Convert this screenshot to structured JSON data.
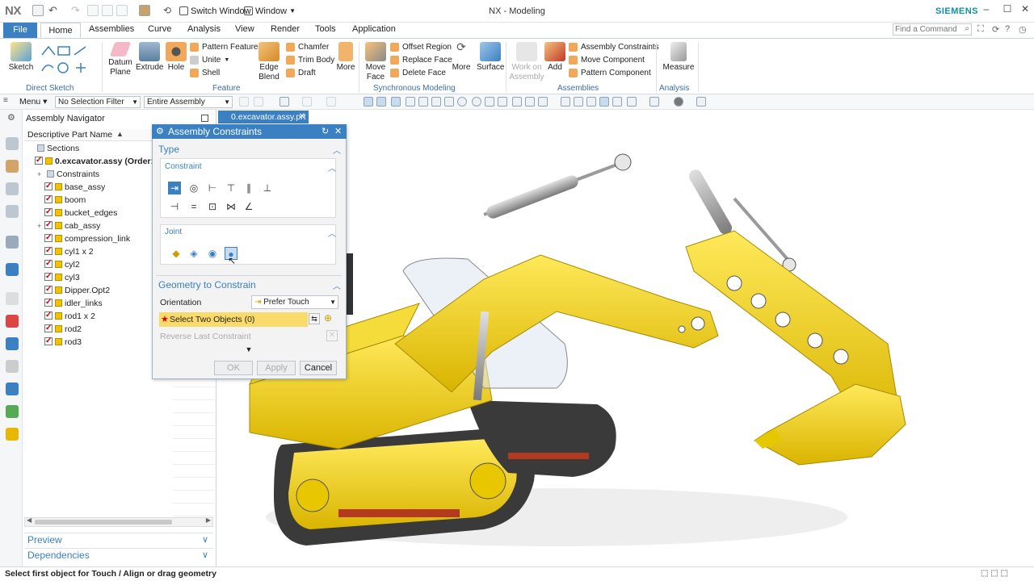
{
  "app": {
    "logo": "NX",
    "title": "NX - Modeling",
    "brand": "SIEMENS"
  },
  "quick_access": {
    "switch_window": "Switch Window",
    "window": "Window"
  },
  "tabs": [
    "File",
    "Home",
    "Assemblies",
    "Curve",
    "Analysis",
    "View",
    "Render",
    "Tools",
    "Application"
  ],
  "search": {
    "placeholder": "Find a Command"
  },
  "ribbon": {
    "direct_sketch": {
      "name": "Direct Sketch",
      "sketch": "Sketch"
    },
    "feature": {
      "name": "Feature",
      "datum_plane": "Datum Plane",
      "extrude": "Extrude",
      "hole": "Hole",
      "pattern_feature": "Pattern Feature",
      "unite": "Unite",
      "shell": "Shell",
      "edge_blend": "Edge Blend",
      "chamfer": "Chamfer",
      "trim_body": "Trim Body",
      "draft": "Draft",
      "more": "More"
    },
    "sync": {
      "name": "Synchronous Modeling",
      "move_face": "Move Face",
      "offset_region": "Offset Region",
      "replace_face": "Replace Face",
      "delete_face": "Delete Face",
      "more": "More",
      "surface": "Surface"
    },
    "assemblies": {
      "name": "Assemblies",
      "work_on_assembly": "Work on Assembly",
      "add": "Add",
      "assembly_constraints": "Assembly Constraints",
      "move_component": "Move Component",
      "pattern_component": "Pattern Component"
    },
    "analysis": {
      "name": "Analysis",
      "measure": "Measure"
    }
  },
  "toolbar": {
    "menu": "Menu",
    "selection_filter": "No Selection Filter",
    "scope": "Entire Assembly"
  },
  "navigator": {
    "title": "Assembly Navigator",
    "column": "Descriptive Part Name",
    "rows": [
      {
        "label": "Sections",
        "indent": 0,
        "checkbox": false,
        "expander": ""
      },
      {
        "label": "0.excavator.assy (Order: A",
        "indent": 0,
        "checkbox": true,
        "expander": "",
        "bold": true
      },
      {
        "label": "Constraints",
        "indent": 1,
        "checkbox": false,
        "expander": "+"
      },
      {
        "label": "base_assy",
        "indent": 1,
        "checkbox": true,
        "expander": ""
      },
      {
        "label": "boom",
        "indent": 1,
        "checkbox": true,
        "expander": ""
      },
      {
        "label": "bucket_edges",
        "indent": 1,
        "checkbox": true,
        "expander": ""
      },
      {
        "label": "cab_assy",
        "indent": 1,
        "checkbox": true,
        "expander": "+"
      },
      {
        "label": "compression_link",
        "indent": 1,
        "checkbox": true,
        "expander": ""
      },
      {
        "label": "cyl1 x 2",
        "indent": 1,
        "checkbox": true,
        "expander": ""
      },
      {
        "label": "cyl2",
        "indent": 1,
        "checkbox": true,
        "expander": ""
      },
      {
        "label": "cyl3",
        "indent": 1,
        "checkbox": true,
        "expander": ""
      },
      {
        "label": "Dipper.Opt2",
        "indent": 1,
        "checkbox": true,
        "expander": ""
      },
      {
        "label": "idler_links",
        "indent": 1,
        "checkbox": true,
        "expander": ""
      },
      {
        "label": "rod1 x 2",
        "indent": 1,
        "checkbox": true,
        "expander": ""
      },
      {
        "label": "rod2",
        "indent": 1,
        "checkbox": true,
        "expander": ""
      },
      {
        "label": "rod3",
        "indent": 1,
        "checkbox": true,
        "expander": ""
      }
    ],
    "preview": "Preview",
    "dependencies": "Dependencies"
  },
  "document_tab": "0.excavator.assy.prt",
  "dialog": {
    "title": "Assembly Constraints",
    "type_section": "Type",
    "constraint_label": "Constraint",
    "joint_label": "Joint",
    "geometry_section": "Geometry to Constrain",
    "orientation_label": "Orientation",
    "orientation_value": "Prefer Touch",
    "select_objects": "Select Two Objects (0)",
    "reverse_last": "Reverse Last Constraint",
    "ok": "OK",
    "apply": "Apply",
    "cancel": "Cancel"
  },
  "status": "Select first object for Touch / Align or drag geometry",
  "colors": {
    "accent": "#3a80c3",
    "brand": "#0f8fa3",
    "model_yellow": "#f3d11c",
    "select_highlight": "#f8db6b"
  }
}
